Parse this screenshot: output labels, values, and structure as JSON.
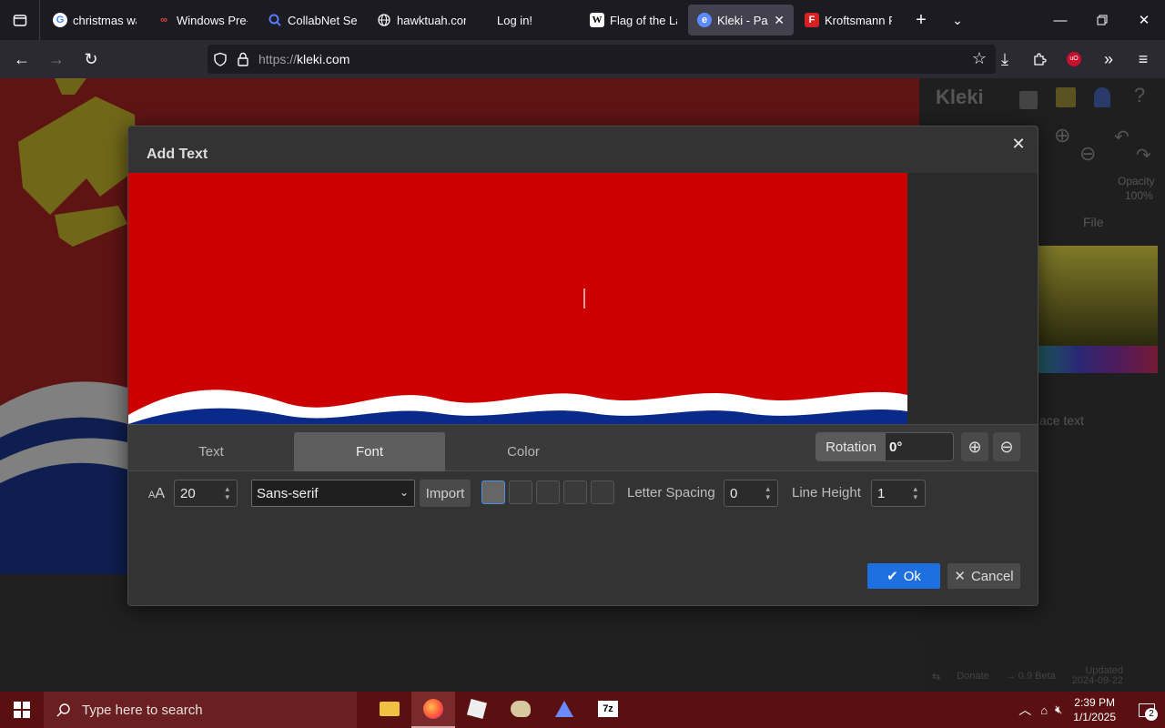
{
  "browser": {
    "tabs": [
      {
        "label": "christmas wall",
        "icon": "google-icon",
        "active": false
      },
      {
        "label": "Windows Pre-",
        "icon": "windows-icon",
        "active": false
      },
      {
        "label": "CollabNet Sear",
        "icon": "search-icon",
        "active": false
      },
      {
        "label": "hawktuah.com",
        "icon": "globe-icon",
        "active": false
      },
      {
        "label": "Log in!",
        "icon": "",
        "active": false
      },
      {
        "label": "Flag of the Lat",
        "icon": "wikipedia-icon",
        "active": false
      },
      {
        "label": "Kleki - Paint",
        "icon": "kleki-icon",
        "active": true
      },
      {
        "label": "Kroftsmann Fo",
        "icon": "f-icon",
        "active": false
      }
    ],
    "url_protocol": "https://",
    "url_host": "kleki.com"
  },
  "dialog": {
    "title": "Add Text",
    "tabs": [
      "Text",
      "Font",
      "Color"
    ],
    "active_tab": "Font",
    "rotation_label": "Rotation",
    "rotation_value": "0°",
    "font_size": "20",
    "font_family": "Sans-serif",
    "import_label": "Import",
    "letter_spacing_label": "Letter Spacing",
    "letter_spacing_value": "0",
    "line_height_label": "Line Height",
    "line_height_value": "1",
    "ok_label": "Ok",
    "cancel_label": "Cancel"
  },
  "background_panel": {
    "logo": "Kleki",
    "opacity_label": "Opacity",
    "opacity_value": "100%",
    "file_label": "File",
    "place_text": "ace text",
    "donate": "Donate",
    "version": "0.9 Beta",
    "updated_label": "Updated",
    "updated_date": "2024-09-22"
  },
  "taskbar": {
    "search_placeholder": "Type here to search",
    "time": "2:39 PM",
    "date": "1/1/2025",
    "notification_count": "2"
  },
  "colors": {
    "flag_red": "#cc0000",
    "flag_blue": "#0a2a8a",
    "accent_blue": "#1e6fe0",
    "taskbar": "#5a1010"
  }
}
